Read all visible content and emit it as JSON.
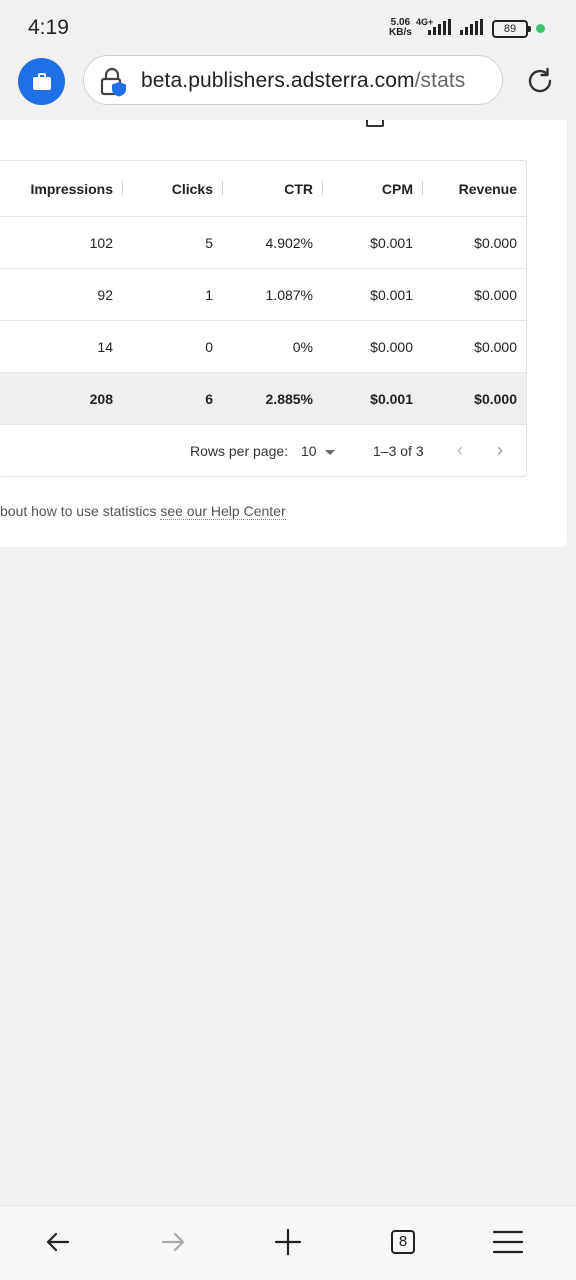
{
  "status_bar": {
    "time": "4:19",
    "net_speed": "5.06",
    "net_unit": "KB/s",
    "network_type": "4G+",
    "battery": "89"
  },
  "browser": {
    "url_domain": "beta.publishers.adsterra.com",
    "url_path": "/stats",
    "tab_count": "8"
  },
  "table": {
    "headers": [
      "Impressions",
      "Clicks",
      "CTR",
      "CPM",
      "Revenue"
    ],
    "rows": [
      [
        "102",
        "5",
        "4.902%",
        "$0.001",
        "$0.000"
      ],
      [
        "92",
        "1",
        "1.087%",
        "$0.001",
        "$0.000"
      ],
      [
        "14",
        "0",
        "0%",
        "$0.000",
        "$0.000"
      ]
    ],
    "total": [
      "208",
      "6",
      "2.885%",
      "$0.001",
      "$0.000"
    ]
  },
  "pagination": {
    "rows_per_page_label": "Rows per page:",
    "rows_per_page_value": "10",
    "range": "1–3 of 3"
  },
  "help": {
    "text": "bout how to use statistics ",
    "link": "see our Help Center"
  },
  "colors": {
    "accent": "#1f6fe5",
    "battery_dot": "#3ec46d",
    "page_bg": "#f1f1f1"
  }
}
